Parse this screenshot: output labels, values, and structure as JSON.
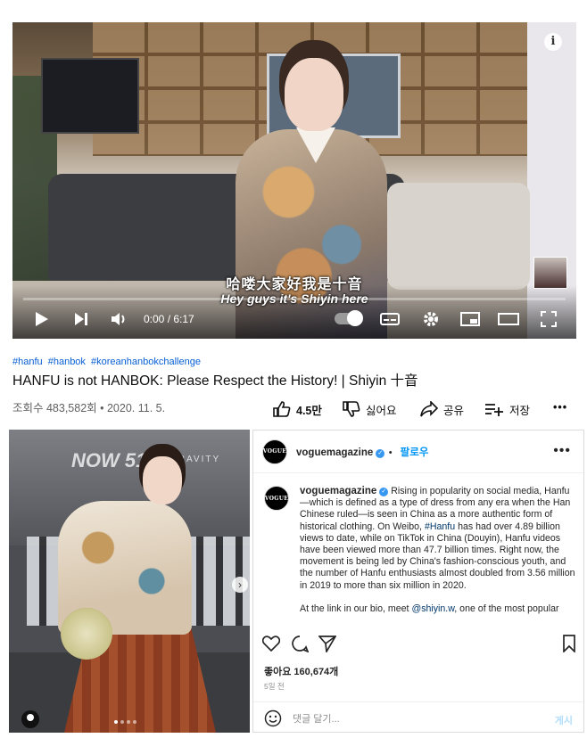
{
  "youtube": {
    "player": {
      "subtitle_cn": "哈喽大家好我是十音",
      "subtitle_en": "Hey guys it's Shiyin here",
      "time": "0:00 / 6:17",
      "progress_fraction": 0.0,
      "info_icon": "info-icon"
    },
    "hashtags": [
      "#hanfu",
      "#hanbok",
      "#koreanhanbokchallenge"
    ],
    "title": "HANFU is not HANBOK: Please Respect the History! | Shiyin 十音",
    "views": "조회수 483,582회 • 2020. 11. 5.",
    "actions": {
      "like_count": "4.5만",
      "dislike_label": "싫어요",
      "share_label": "공유",
      "save_label": "저장",
      "more": "•••"
    }
  },
  "instagram": {
    "account": "voguemagazine",
    "avatar_text": "VOGUE",
    "follow_label": "팔로우",
    "more_icon": "•••",
    "caption_paragraph1_pre": "Rising in popularity on social media, Hanfu—which is defined as a type of dress from any era when the Han Chinese ruled—is seen in China as a more authentic form of historical clothing. On Weibo, ",
    "caption_hashtag": "#Hanfu",
    "caption_paragraph1_post": " has had over 4.89 billion views to date, while on TikTok in China (Douyin), Hanfu videos have been viewed more than 47.7 billion times. Right now, the movement is being led by China's fashion-conscious youth, and the number of Hanfu enthusiasts almost doubled from 3.56 million in 2019 to more than six million in 2020.",
    "caption_paragraph2_pre": "At the link in our bio, meet ",
    "caption_mention": "@shiyin.w",
    "caption_paragraph2_post": ", one of the most popular",
    "likes": "좋아요 160,674개",
    "posted_ago": "5일 전",
    "comment_placeholder": "댓글 달기...",
    "post_button": "게시",
    "photo": {
      "sign_text_1": "NOW 51",
      "sign_text_2": "GRAVITY",
      "carousel_dots": 4,
      "carousel_active_index": 0
    }
  },
  "colors": {
    "youtube_red": "#ff0000",
    "link_blue": "#065fd4",
    "ig_blue": "#0095f6",
    "ig_text": "#262626"
  }
}
